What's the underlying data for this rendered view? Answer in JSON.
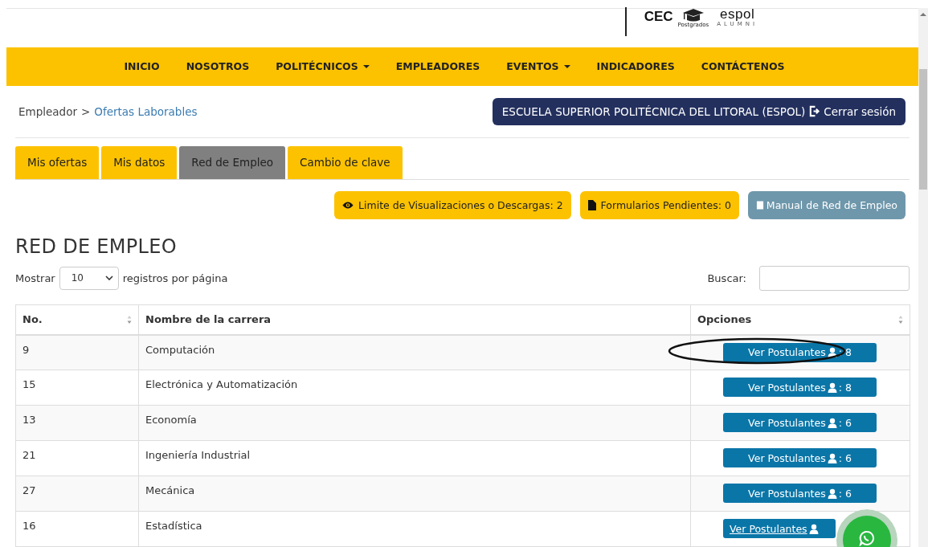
{
  "header": {
    "logo_cec": "CEC",
    "logo_postgrados": "Postgrados",
    "logo_espol": "espol",
    "logo_alumni": "ALUMNI"
  },
  "nav": [
    {
      "label": "INICIO",
      "dropdown": false
    },
    {
      "label": "NOSOTROS",
      "dropdown": false
    },
    {
      "label": "POLITÉCNICOS",
      "dropdown": true
    },
    {
      "label": "EMPLEADORES",
      "dropdown": false
    },
    {
      "label": "EVENTOS",
      "dropdown": true
    },
    {
      "label": "INDICADORES",
      "dropdown": false
    },
    {
      "label": "CONTÁCTENOS",
      "dropdown": false
    }
  ],
  "breadcrumb": {
    "parent": "Empleador",
    "separator": ">",
    "current": "Ofertas Laborables"
  },
  "account": {
    "institution": "ESCUELA SUPERIOR POLITÉCNICA DEL LITORAL (ESPOL)",
    "logout": "Cerrar sesión"
  },
  "tabs": [
    {
      "label": "Mis ofertas",
      "selected": false
    },
    {
      "label": "Mis datos",
      "selected": false
    },
    {
      "label": "Red de Empleo",
      "selected": true
    },
    {
      "label": "Cambio de clave",
      "selected": false
    }
  ],
  "badges": [
    {
      "kind": "eye",
      "label": "Limite de Visualizaciones o Descargas: 2"
    },
    {
      "kind": "file",
      "label": "Formularios Pendientes: 0"
    },
    {
      "kind": "manual",
      "label": "Manual de Red de Empleo"
    }
  ],
  "title": "RED DE EMPLEO",
  "length_menu": {
    "before": "Mostrar",
    "value": "10",
    "after": "registros por página"
  },
  "search": {
    "label": "Buscar:"
  },
  "table": {
    "columns": [
      {
        "label": "No.",
        "sortable": true
      },
      {
        "label": "Nombre de la carrera",
        "sortable": false
      },
      {
        "label": "Opciones",
        "sortable": true
      }
    ],
    "rows": [
      {
        "no": "9",
        "career": "Computación",
        "action": "Ver Postulantes",
        "count": ": 8",
        "circled": true,
        "hover": false
      },
      {
        "no": "15",
        "career": "Electrónica y Automatización",
        "action": "Ver Postulantes",
        "count": ": 8",
        "circled": false,
        "hover": false
      },
      {
        "no": "13",
        "career": "Economía",
        "action": "Ver Postulantes",
        "count": ": 6",
        "circled": false,
        "hover": false
      },
      {
        "no": "21",
        "career": "Ingeniería Industrial",
        "action": "Ver Postulantes",
        "count": ": 6",
        "circled": false,
        "hover": false
      },
      {
        "no": "27",
        "career": "Mecánica",
        "action": "Ver Postulantes",
        "count": ": 6",
        "circled": false,
        "hover": false
      },
      {
        "no": "16",
        "career": "Estadística",
        "action": "Ver Postulantes",
        "circled": false,
        "hover": true
      }
    ]
  },
  "whatsapp_button": true
}
